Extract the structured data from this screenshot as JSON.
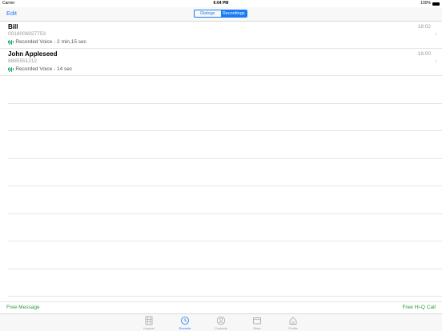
{
  "status_bar": {
    "carrier": "Carrier",
    "time": "6:04 PM",
    "battery": "100%"
  },
  "nav": {
    "edit_label": "Edit",
    "segments": [
      {
        "label": "Dialogs",
        "active": false
      },
      {
        "label": "Recordings",
        "active": true
      }
    ]
  },
  "recordings": [
    {
      "name": "Bill",
      "number": "0018006927753",
      "description": "Recorded Voice - 2 min,15 sec",
      "time": "18:02"
    },
    {
      "name": "John Appleseed",
      "number": "8885551212",
      "description": "Recorded Voice - 14 sec",
      "time": "18:00"
    }
  ],
  "bottom_bar": {
    "left_label": "Free Message",
    "right_label": "Free Hi-Q Call"
  },
  "tabs": [
    {
      "label": "Keypad",
      "icon": "keypad-icon",
      "active": false
    },
    {
      "label": "Recents",
      "icon": "recents-icon",
      "active": true
    },
    {
      "label": "Contacts",
      "icon": "contacts-icon",
      "active": false
    },
    {
      "label": "Store",
      "icon": "store-icon",
      "active": false
    },
    {
      "label": "Profile",
      "icon": "profile-icon",
      "active": false
    }
  ],
  "colors": {
    "accent": "#1a7cf5",
    "green": "#2b9b3a"
  }
}
